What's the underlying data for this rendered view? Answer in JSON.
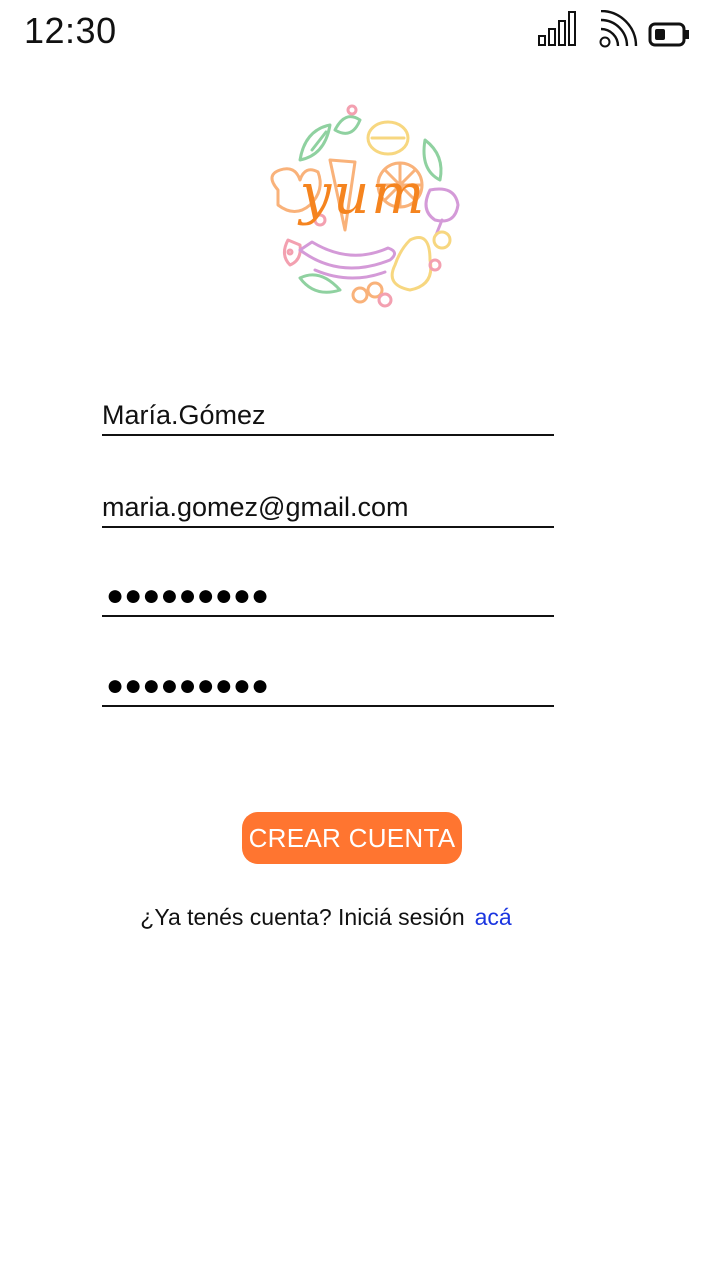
{
  "status_bar": {
    "time": "12:30",
    "icons": [
      "signal-icon",
      "wifi-icon",
      "battery-icon"
    ]
  },
  "logo": {
    "text": "yum",
    "colors": {
      "text": "#f5841f",
      "green": "#8fd1a0",
      "pink": "#f3a0b0",
      "purple": "#d49ad8",
      "yellow": "#f7d780",
      "orange": "#f9b27a"
    }
  },
  "form": {
    "username": "María.Gómez",
    "email": "maria.gomez@gmail.com",
    "password_mask": "●●●●●●●●●",
    "confirm_password_mask": "●●●●●●●●●"
  },
  "actions": {
    "create_account_label": "CREAR CUENTA",
    "login_prompt": "¿Ya tenés cuenta? Iniciá sesión",
    "login_link": "acá"
  },
  "colors": {
    "button_bg": "#ff7530",
    "button_text": "#ffffff",
    "link": "#1a35e0",
    "underline": "#111111"
  }
}
